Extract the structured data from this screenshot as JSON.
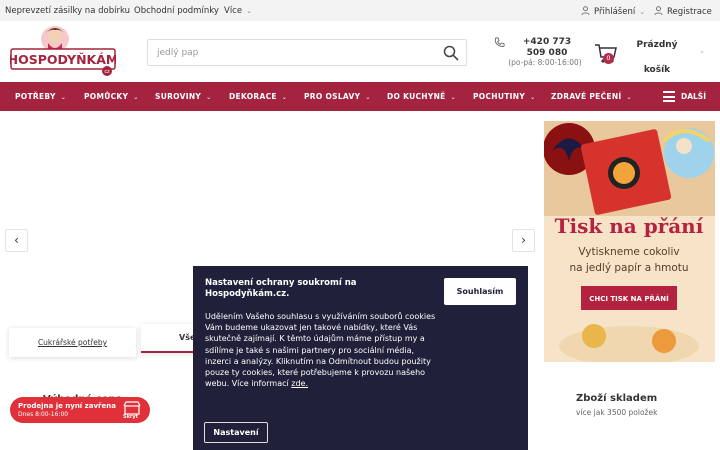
{
  "topbar": {
    "links": [
      "Neprevzetí zásilky na dobírku",
      "Obchodní podmínky"
    ],
    "more_label": "Více",
    "login_label": "Přihlášení",
    "register_label": "Registrace"
  },
  "logo": {
    "text": "HOSPODYŇKÁM",
    "suffix": "cz"
  },
  "search": {
    "value": "",
    "placeholder": "jedlý pap"
  },
  "contact": {
    "phone": "+420 773 509 080",
    "hours": "(po-pá: 8:00-16:00)"
  },
  "cart": {
    "count": "0",
    "label": "Prázdný košík"
  },
  "nav": {
    "items": [
      "POTŘEBY",
      "POMŮCKY",
      "SUROVINY",
      "DEKORACE",
      "PRO OSLAVY",
      "DO KUCHYNĚ",
      "POCHUTINY",
      "ZDRAVÉ PEČENÍ"
    ],
    "more_label": "DALŠÍ"
  },
  "slider": {
    "prev": "‹",
    "next": "›"
  },
  "banner": {
    "headline": "Tisk na přání",
    "subline1": "Vytiskneme cokoliv",
    "subline2": "na jedlý papír a hmotu",
    "cta": "CHCI TISK NA PŘÁNÍ"
  },
  "tabs": {
    "tab1": "Cukrářské potřeby",
    "tab2": "Vše"
  },
  "features": {
    "left_title": "Výhodná cena",
    "right_title": "Zboží skladem",
    "right_sub": "více jak 3500 položek"
  },
  "store_status": {
    "line1": "Prodejna je nyní zavřena",
    "line2": "Dnes 8:00-16:00",
    "hide": "Skrýt"
  },
  "cookie": {
    "title": "Nastavení ochrany soukromí na Hospodyňkám.cz.",
    "body": "Udělením Vašeho souhlasu s využíváním souborů cookies Vám budeme ukazovat jen takové nabídky, které Vás skutečně zajímají. K těmto údajům máme přístup my a sdílíme je také s našimi partnery pro sociální média, inzerci a analýzy. Kliknutím na Odmítnout budou použity pouze ty cookies, které potřebujeme k provozu našeho webu. Více informací",
    "link": "zde.",
    "agree": "Souhlasím",
    "settings": "Nastavení"
  },
  "colors": {
    "brand": "#a4233f",
    "dialog": "#20203a",
    "status": "#e0313b"
  }
}
